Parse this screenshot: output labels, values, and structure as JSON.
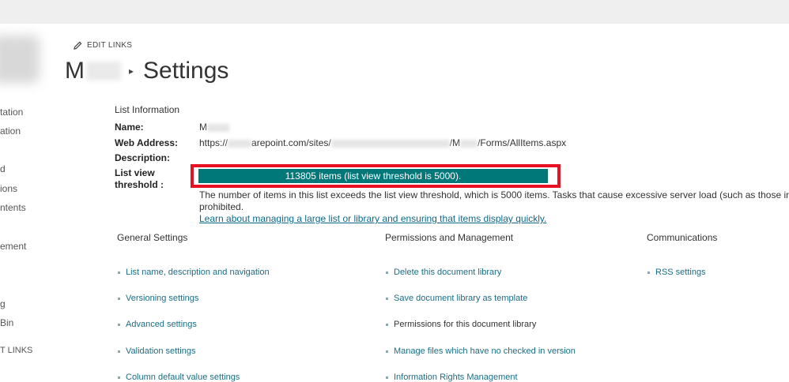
{
  "leftnav": {
    "items": [
      "tation",
      "ation",
      "d",
      "ions",
      "ntents",
      "ement",
      "g",
      " Bin",
      "T LINKS"
    ]
  },
  "edit_links": "EDIT LINKS",
  "breadcrumb": {
    "site": "M",
    "separator": "▸",
    "page": "Settings"
  },
  "list_info": {
    "section_title": "List Information",
    "name_label": "Name:",
    "name_value": "M",
    "web_address_label": "Web Address:",
    "web_address_parts": [
      "https://",
      "arepoint.com/sites/",
      "/M",
      "/Forms/AllItems.aspx"
    ],
    "description_label": "Description:",
    "threshold_label_1": "List view",
    "threshold_label_2": "threshold :",
    "threshold_status": "113805 items (list view threshold is 5000).",
    "warning_line1": "The number of items in this list exceeds the list view threshold, which is 5000 items. Tasks that cause excessive server load (such as those involving",
    "warning_line2": "prohibited.",
    "learn_link": "Learn about managing a large list or library and ensuring that items display quickly."
  },
  "columns": {
    "general": {
      "heading": "General Settings",
      "links": [
        "List name, description and navigation",
        "Versioning settings",
        "Advanced settings",
        "Validation settings",
        "Column default value settings"
      ]
    },
    "permissions": {
      "heading": "Permissions and Management",
      "links": [
        "Delete this document library",
        "Save document library as template",
        "Permissions for this document library",
        "Manage files which have no checked in version",
        "Information Rights Management"
      ]
    },
    "communications": {
      "heading": "Communications",
      "links": [
        "RSS settings"
      ]
    }
  },
  "colors": {
    "threshold_bar": "#00787a",
    "highlight_border": "#e81123",
    "link": "#1a6e86"
  }
}
